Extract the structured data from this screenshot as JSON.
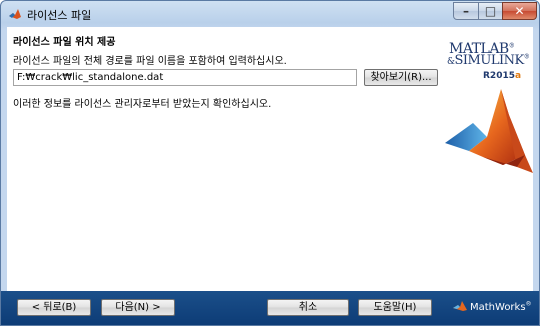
{
  "window": {
    "title": "라이선스 파일"
  },
  "page": {
    "heading": "라이선스 파일 위치 제공",
    "instruction": "라이선스 파일의 전체 경로를 파일 이름을 포함하여 입력하십시오.",
    "path_value": "F:₩crack₩lic_standalone.dat",
    "browse_label": "찾아보기(R)...",
    "note": "이러한 정보를 라이선스 관리자로부터 받았는지 확인하십시오."
  },
  "branding": {
    "line1": "MATLAB",
    "line1_mark": "®",
    "line2_prefix": "&",
    "line2": "SIMULINK",
    "line2_mark": "®",
    "release": "R2015",
    "release_suffix": "a",
    "vendor": "MathWorks",
    "vendor_mark": "®"
  },
  "footer": {
    "back_label": "< 뒤로(B)",
    "next_label": "다음(N) >",
    "cancel_label": "취소",
    "help_label": "도움말(H)"
  },
  "colors": {
    "bottom_bar": "#0d3c76",
    "logo_text": "#203a6e",
    "release_accent": "#e07a10"
  },
  "icons": {
    "app": "matlab-icon",
    "minimize": "minimize-icon",
    "maximize": "maximize-icon",
    "close": "close-icon",
    "vendor": "mathworks-logo-icon"
  }
}
